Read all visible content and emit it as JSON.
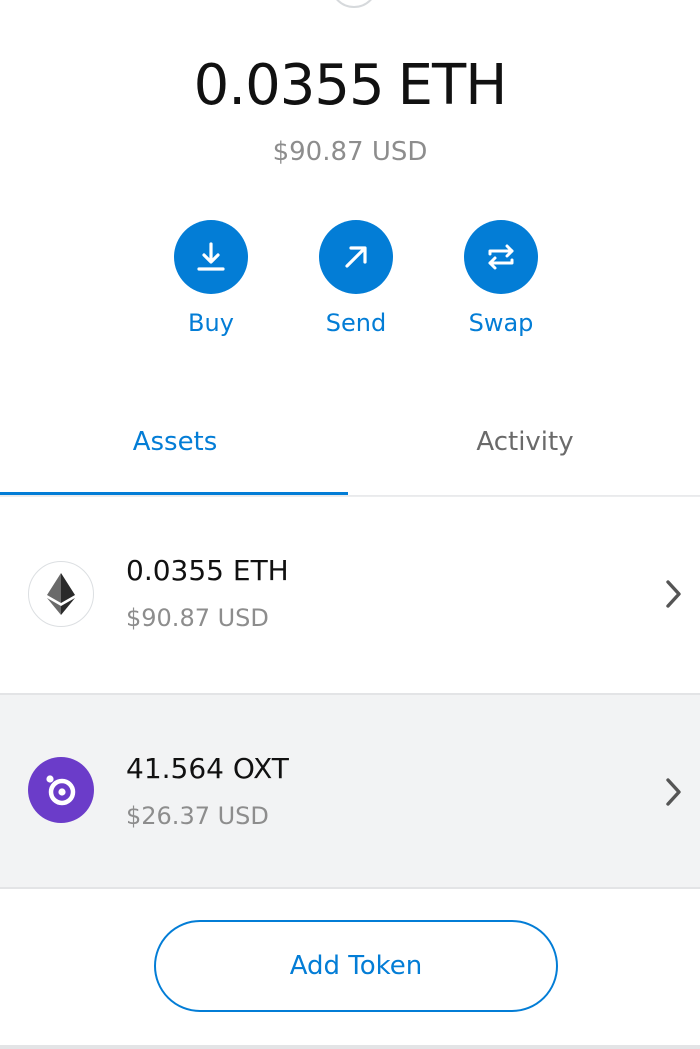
{
  "balance": {
    "amount": "0.0355",
    "unit": "ETH",
    "fiat": "$90.87 USD"
  },
  "actions": {
    "buy": {
      "label": "Buy",
      "icon": "download-icon"
    },
    "send": {
      "label": "Send",
      "icon": "arrow-up-right-icon"
    },
    "swap": {
      "label": "Swap",
      "icon": "swap-icon"
    }
  },
  "tabs": [
    {
      "label": "Assets",
      "active": true
    },
    {
      "label": "Activity",
      "active": false
    }
  ],
  "assets": [
    {
      "amount": "0.0355 ETH",
      "fiat": "$90.87 USD",
      "icon": "ethereum-icon"
    },
    {
      "amount": "41.564 OXT",
      "fiat": "$26.37 USD",
      "icon": "orchid-icon"
    }
  ],
  "add_token_label": "Add Token",
  "colors": {
    "accent": "#037dd6",
    "oxt_purple": "#6b3cc9",
    "muted_text": "#8d8d8d"
  }
}
